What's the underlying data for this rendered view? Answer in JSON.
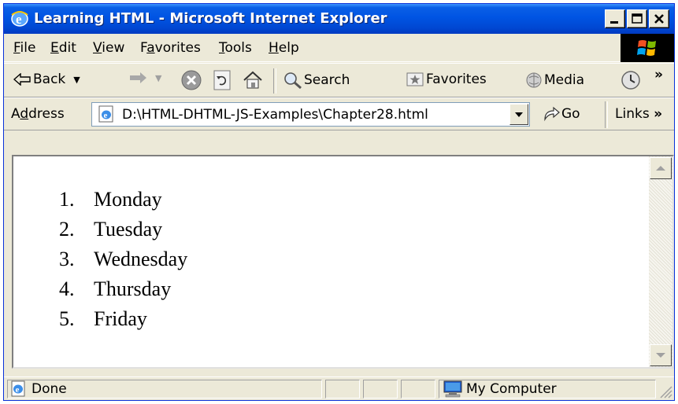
{
  "window": {
    "title": "Learning HTML - Microsoft Internet Explorer",
    "controls": [
      "minimize",
      "maximize",
      "close"
    ]
  },
  "menu": {
    "items": [
      {
        "label": "File",
        "accel": "F"
      },
      {
        "label": "Edit",
        "accel": "E"
      },
      {
        "label": "View",
        "accel": "V"
      },
      {
        "label": "Favorites",
        "accel": "a"
      },
      {
        "label": "Tools",
        "accel": "T"
      },
      {
        "label": "Help",
        "accel": "H"
      }
    ]
  },
  "toolbar": {
    "back_label": "Back",
    "search_label": "Search",
    "favorites_label": "Favorites",
    "media_label": "Media",
    "more_label": "»"
  },
  "address": {
    "label": "Address",
    "url": "D:\\HTML-DHTML-JS-Examples\\Chapter28.html",
    "go_label": "Go",
    "links_label": "Links",
    "more_label": "»"
  },
  "page": {
    "list": [
      {
        "num": "1.",
        "text": "Monday"
      },
      {
        "num": "2.",
        "text": "Tuesday"
      },
      {
        "num": "3.",
        "text": "Wednesday"
      },
      {
        "num": "4.",
        "text": "Thursday"
      },
      {
        "num": "5.",
        "text": "Friday"
      }
    ]
  },
  "status": {
    "text": "Done",
    "zone": "My Computer"
  },
  "colors": {
    "titlebar": "#0054e3",
    "chrome": "#ece9d8",
    "close_x": "#000000"
  },
  "icons": {
    "title": "ie-logo-icon",
    "back": "back-arrow-icon",
    "forward": "forward-arrow-icon",
    "stop": "stop-icon",
    "refresh": "refresh-icon",
    "home": "home-icon",
    "search": "search-icon",
    "favorites": "favorites-icon",
    "media": "media-icon",
    "history": "history-icon",
    "page": "ie-page-icon",
    "go": "go-arrow-icon",
    "status": "ie-status-icon",
    "computer": "computer-icon"
  }
}
